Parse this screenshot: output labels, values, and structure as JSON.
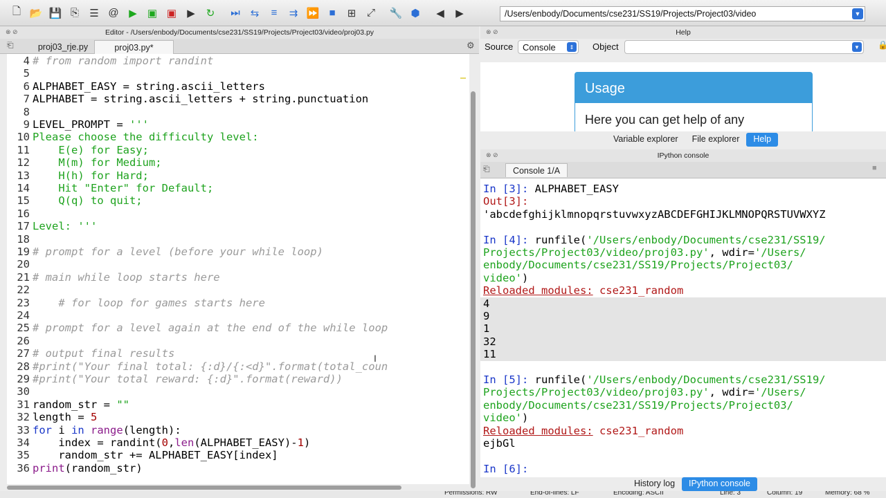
{
  "toolbar": {
    "path": "/Users/enbody/Documents/cse231/SS19/Projects/Project03/video"
  },
  "editor": {
    "title": "Editor - /Users/enbody/Documents/cse231/SS19/Projects/Project03/video/proj03.py",
    "tabs": [
      "proj03_rje.py",
      "proj03.py*"
    ],
    "lines": [
      {
        "n": "4",
        "t": "# from random import randint"
      },
      {
        "n": "5",
        "t": ""
      },
      {
        "n": "6",
        "t": "ALPHABET_EASY = string.ascii_letters"
      },
      {
        "n": "7",
        "t": "ALPHABET = string.ascii_letters + string.punctuation"
      },
      {
        "n": "8",
        "t": ""
      },
      {
        "n": "9",
        "t": "LEVEL_PROMPT = '''"
      },
      {
        "n": "10",
        "t": "Please choose the difficulty level:"
      },
      {
        "n": "11",
        "t": "    E(e) for Easy;"
      },
      {
        "n": "12",
        "t": "    M(m) for Medium;"
      },
      {
        "n": "13",
        "t": "    H(h) for Hard;"
      },
      {
        "n": "14",
        "t": "    Hit \"Enter\" for Default;"
      },
      {
        "n": "15",
        "t": "    Q(q) to quit;"
      },
      {
        "n": "16",
        "t": ""
      },
      {
        "n": "17",
        "t": "Level: '''"
      },
      {
        "n": "18",
        "t": ""
      },
      {
        "n": "19",
        "t": "# prompt for a level (before your while loop)"
      },
      {
        "n": "20",
        "t": ""
      },
      {
        "n": "21",
        "t": "# main while loop starts here"
      },
      {
        "n": "22",
        "t": ""
      },
      {
        "n": "23",
        "t": "    # for loop for games starts here"
      },
      {
        "n": "24",
        "t": ""
      },
      {
        "n": "25",
        "t": "# prompt for a level again at the end of the while loop"
      },
      {
        "n": "26",
        "t": ""
      },
      {
        "n": "27",
        "t": "# output final results"
      },
      {
        "n": "28",
        "t": "#print(\"Your final total: {:d}/{:<d}\".format(total_coun"
      },
      {
        "n": "29",
        "t": "#print(\"Your total reward: {:d}\".format(reward))"
      },
      {
        "n": "30",
        "t": ""
      },
      {
        "n": "31",
        "t": "random_str = \"\""
      },
      {
        "n": "32",
        "t": "length = 5"
      },
      {
        "n": "33",
        "t": "for i in range(length):"
      },
      {
        "n": "34",
        "t": "    index = randint(0,len(ALPHABET_EASY)-1)"
      },
      {
        "n": "35",
        "t": "    random_str += ALPHABET_EASY[index]"
      },
      {
        "n": "36",
        "t": "print(random_str)"
      }
    ]
  },
  "help": {
    "title": "Help",
    "source_label": "Source",
    "source_value": "Console",
    "object_label": "Object",
    "usage_title": "Usage",
    "usage_text": "Here you can get help of any",
    "tabs": [
      "Variable explorer",
      "File explorer",
      "Help"
    ]
  },
  "console": {
    "title": "IPython console",
    "tab": "Console 1/A",
    "lines": [
      {
        "t": "In [3]: ALPHABET_EASY",
        "k": "in"
      },
      {
        "t": "Out[3]:",
        "k": "out"
      },
      {
        "t": "'abcdefghijklmnopqrstuvwxyzABCDEFGHIJKLMNOPQRSTUVWXYZ",
        "k": "plain"
      },
      {
        "t": "",
        "k": "plain"
      },
      {
        "t": "In [4]: runfile('/Users/enbody/Documents/cse231/SS19/",
        "k": "in"
      },
      {
        "t": "Projects/Project03/video/proj03.py', wdir='/Users/",
        "k": "str"
      },
      {
        "t": "enbody/Documents/cse231/SS19/Projects/Project03/",
        "k": "str"
      },
      {
        "t": "video')",
        "k": "str"
      },
      {
        "t": "Reloaded modules: cse231_random",
        "k": "rel"
      },
      {
        "t": "4",
        "k": "plain"
      },
      {
        "t": "9",
        "k": "plain"
      },
      {
        "t": "1",
        "k": "plain"
      },
      {
        "t": "32",
        "k": "plain"
      },
      {
        "t": "11",
        "k": "plain"
      },
      {
        "t": "",
        "k": "plain"
      },
      {
        "t": "In [5]: runfile('/Users/enbody/Documents/cse231/SS19/",
        "k": "in"
      },
      {
        "t": "Projects/Project03/video/proj03.py', wdir='/Users/",
        "k": "str"
      },
      {
        "t": "enbody/Documents/cse231/SS19/Projects/Project03/",
        "k": "str"
      },
      {
        "t": "video')",
        "k": "str"
      },
      {
        "t": "Reloaded modules: cse231_random",
        "k": "rel"
      },
      {
        "t": "ejbGl",
        "k": "plain"
      },
      {
        "t": "",
        "k": "plain"
      },
      {
        "t": "In [6]:",
        "k": "in"
      }
    ],
    "tabs": [
      "History log",
      "IPython console"
    ]
  },
  "status": {
    "permissions": "Permissions: RW",
    "eol": "End-of-lines: LF",
    "encoding": "Encoding: ASCII",
    "line": "Line: 3",
    "column": "Column: 19",
    "memory": "Memory: 68 %"
  }
}
